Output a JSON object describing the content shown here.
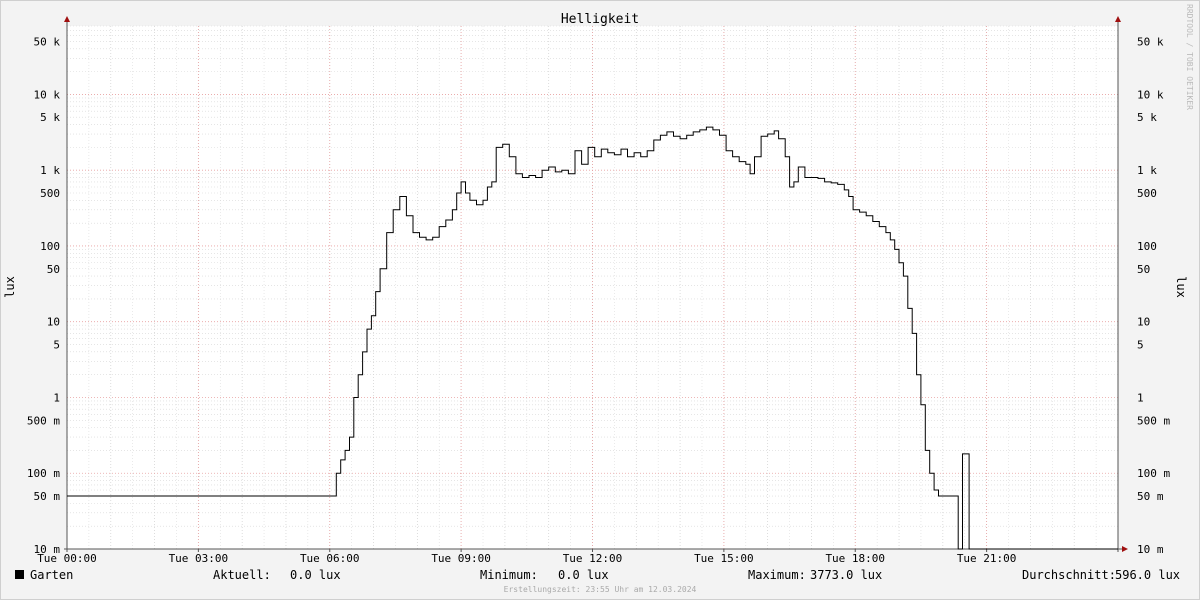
{
  "chart_data": {
    "type": "line",
    "title": "Helligkeit",
    "ylabel": "lux",
    "y_scale": "log",
    "ylim": [
      0.01,
      80000
    ],
    "xlim": [
      0,
      24
    ],
    "x_tick_labels": [
      "Tue 00:00",
      "Tue 03:00",
      "Tue 06:00",
      "Tue 09:00",
      "Tue 12:00",
      "Tue 15:00",
      "Tue 18:00",
      "Tue 21:00"
    ],
    "x_tick_hours": [
      0,
      3,
      6,
      9,
      12,
      15,
      18,
      21
    ],
    "y_tick_labels": [
      "50 k",
      "10 k",
      "5 k",
      "1 k",
      "500",
      "100",
      "50",
      "10",
      "5",
      "1",
      "500 m",
      "100 m",
      "50 m",
      "10 m"
    ],
    "y_tick_values": [
      50000,
      10000,
      5000,
      1000,
      500,
      100,
      50,
      10,
      5,
      1,
      0.5,
      0.1,
      0.05,
      0.01
    ],
    "grid": true,
    "watermark": "RRDTOOL / TOBI OETIKER",
    "series": [
      {
        "name": "Garten",
        "color": "#000000",
        "points": [
          [
            0.0,
            0.05
          ],
          [
            6.1,
            0.05
          ],
          [
            6.15,
            0.1
          ],
          [
            6.25,
            0.15
          ],
          [
            6.35,
            0.2
          ],
          [
            6.45,
            0.3
          ],
          [
            6.55,
            1
          ],
          [
            6.65,
            2
          ],
          [
            6.75,
            4
          ],
          [
            6.85,
            8
          ],
          [
            6.95,
            12
          ],
          [
            7.05,
            25
          ],
          [
            7.15,
            50
          ],
          [
            7.3,
            150
          ],
          [
            7.45,
            300
          ],
          [
            7.6,
            450
          ],
          [
            7.75,
            250
          ],
          [
            7.9,
            150
          ],
          [
            8.05,
            130
          ],
          [
            8.2,
            120
          ],
          [
            8.35,
            130
          ],
          [
            8.5,
            180
          ],
          [
            8.65,
            220
          ],
          [
            8.8,
            300
          ],
          [
            8.9,
            500
          ],
          [
            9.0,
            700
          ],
          [
            9.1,
            500
          ],
          [
            9.2,
            400
          ],
          [
            9.35,
            350
          ],
          [
            9.5,
            400
          ],
          [
            9.6,
            600
          ],
          [
            9.7,
            700
          ],
          [
            9.8,
            2000
          ],
          [
            9.95,
            2200
          ],
          [
            10.1,
            1500
          ],
          [
            10.25,
            900
          ],
          [
            10.4,
            800
          ],
          [
            10.55,
            850
          ],
          [
            10.7,
            800
          ],
          [
            10.85,
            1000
          ],
          [
            11.0,
            1100
          ],
          [
            11.15,
            950
          ],
          [
            11.3,
            1000
          ],
          [
            11.45,
            900
          ],
          [
            11.6,
            1800
          ],
          [
            11.75,
            1200
          ],
          [
            11.9,
            2000
          ],
          [
            12.05,
            1500
          ],
          [
            12.2,
            1900
          ],
          [
            12.35,
            1700
          ],
          [
            12.5,
            1600
          ],
          [
            12.65,
            1900
          ],
          [
            12.8,
            1500
          ],
          [
            12.95,
            1700
          ],
          [
            13.1,
            1500
          ],
          [
            13.25,
            1800
          ],
          [
            13.4,
            2500
          ],
          [
            13.55,
            2900
          ],
          [
            13.7,
            3200
          ],
          [
            13.85,
            2800
          ],
          [
            14.0,
            2600
          ],
          [
            14.15,
            2900
          ],
          [
            14.3,
            3200
          ],
          [
            14.45,
            3400
          ],
          [
            14.6,
            3700
          ],
          [
            14.75,
            3400
          ],
          [
            14.9,
            2900
          ],
          [
            15.05,
            1800
          ],
          [
            15.2,
            1500
          ],
          [
            15.35,
            1300
          ],
          [
            15.5,
            1200
          ],
          [
            15.6,
            900
          ],
          [
            15.7,
            1500
          ],
          [
            15.85,
            2800
          ],
          [
            16.0,
            3000
          ],
          [
            16.15,
            3300
          ],
          [
            16.25,
            2600
          ],
          [
            16.4,
            1500
          ],
          [
            16.5,
            600
          ],
          [
            16.6,
            700
          ],
          [
            16.7,
            1100
          ],
          [
            16.85,
            800
          ],
          [
            17.0,
            800
          ],
          [
            17.15,
            780
          ],
          [
            17.3,
            700
          ],
          [
            17.45,
            680
          ],
          [
            17.6,
            650
          ],
          [
            17.75,
            550
          ],
          [
            17.85,
            450
          ],
          [
            17.95,
            300
          ],
          [
            18.1,
            280
          ],
          [
            18.25,
            250
          ],
          [
            18.4,
            210
          ],
          [
            18.55,
            180
          ],
          [
            18.7,
            150
          ],
          [
            18.8,
            120
          ],
          [
            18.9,
            90
          ],
          [
            19.0,
            60
          ],
          [
            19.1,
            40
          ],
          [
            19.2,
            15
          ],
          [
            19.3,
            7
          ],
          [
            19.4,
            2
          ],
          [
            19.5,
            0.8
          ],
          [
            19.6,
            0.2
          ],
          [
            19.7,
            0.1
          ],
          [
            19.8,
            0.06
          ],
          [
            19.9,
            0.05
          ],
          [
            20.1,
            0.05
          ],
          [
            20.25,
            0.05
          ],
          [
            20.35,
            0.001
          ],
          [
            20.45,
            0.18
          ],
          [
            20.55,
            0.18
          ],
          [
            20.6,
            0.001
          ],
          [
            24.0,
            0.001
          ]
        ]
      }
    ]
  },
  "legend": {
    "series_name": "Garten",
    "series_color": "#000000",
    "current_label": "Aktuell:",
    "current_value": "0.0 lux",
    "min_label": "Minimum:",
    "min_value": "0.0 lux",
    "max_label": "Maximum:",
    "max_value": "3773.0 lux",
    "avg_label": "Durchschnitt:",
    "avg_value": "596.0 lux"
  },
  "footer": {
    "created_text": "Erstellungszeit: 23:55 Uhr am 12.03.2024"
  }
}
